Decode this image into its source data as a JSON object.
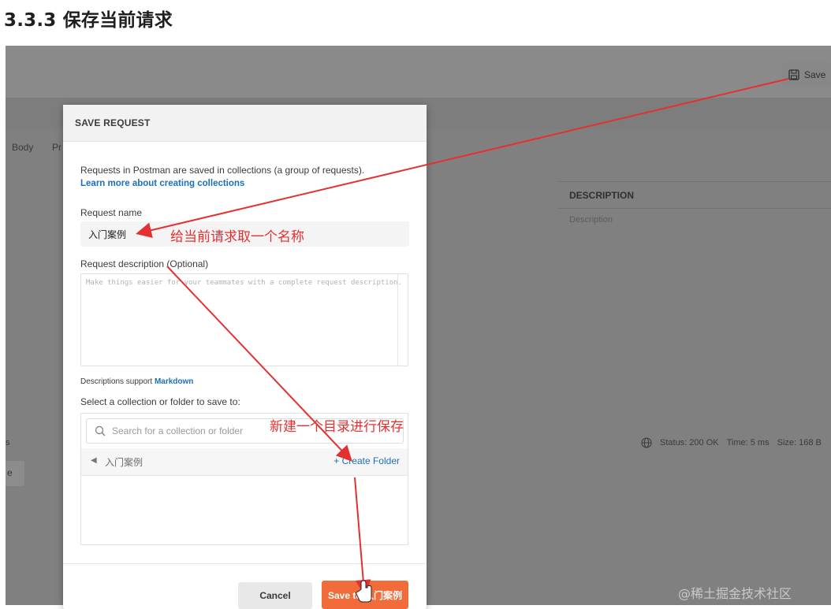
{
  "doc": {
    "heading": "3.3.3 保存当前请求"
  },
  "background": {
    "save_label": "Save",
    "tab_body": "Body",
    "tab_pr": "Pr",
    "desc_header": "DESCRIPTION",
    "desc_placeholder": "Description",
    "status": "Status: 200 OK",
    "time": "Time: 5 ms",
    "size": "Size: 168 B",
    "left_chip": "e",
    "left_s": "s"
  },
  "modal": {
    "title": "SAVE REQUEST",
    "intro": "Requests in Postman are saved in collections (a group of requests).",
    "learn_link": "Learn more about creating collections",
    "name_label": "Request name",
    "name_value": "入门案例",
    "desc_label": "Request description (Optional)",
    "desc_placeholder": "Make things easier for your teammates with a complete request description.",
    "markdown_note": "Descriptions support",
    "markdown_link": "Markdown",
    "collection_label": "Select a collection or folder to save to:",
    "search_placeholder": "Search for a collection or folder",
    "folder_name": "入门案例",
    "create_folder": "+ Create Folder",
    "cancel": "Cancel",
    "save_to": "Save to 入门案例"
  },
  "annotations": {
    "name_note": "给当前请求取一个名称",
    "folder_note": "新建一个目录进行保存",
    "color": "#e53030"
  },
  "watermark": "@稀土掘金技术社区"
}
